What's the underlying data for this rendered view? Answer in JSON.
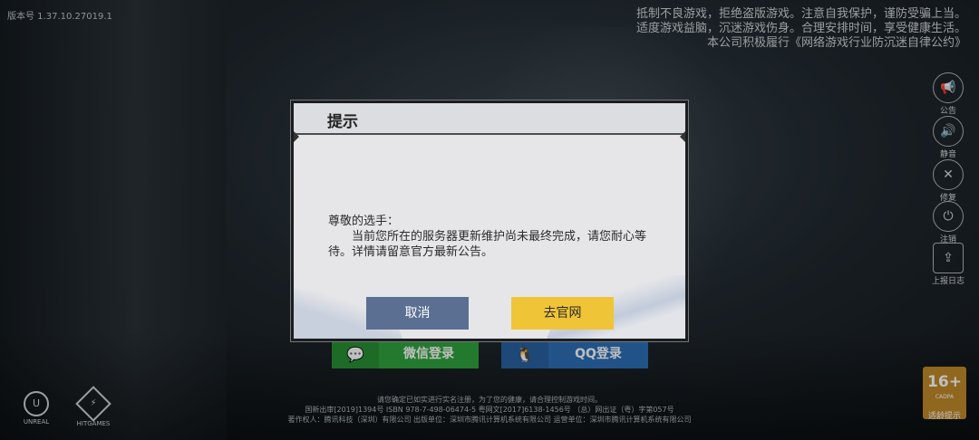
{
  "version": "版本号 1.37.10.27019.1",
  "notice": {
    "line1": "抵制不良游戏，拒绝盗版游戏。注意自我保护，谨防受骗上当。",
    "line2": "适度游戏益脑，沉迷游戏伤身。合理安排时间，享受健康生活。",
    "line3": "本公司积极履行《网络游戏行业防沉迷自律公约》"
  },
  "side_buttons": [
    {
      "icon": "megaphone-icon",
      "label": "公告"
    },
    {
      "icon": "speaker-icon",
      "label": "静音"
    },
    {
      "icon": "repair-icon",
      "label": "修复"
    },
    {
      "icon": "power-icon",
      "label": "注销"
    },
    {
      "icon": "upload-icon",
      "label": "上报日志"
    }
  ],
  "login": {
    "wechat_label": "微信登录",
    "qq_label": "QQ登录"
  },
  "legal": {
    "line1": "请您确定已如实进行实名注册，为了您的健康，请合理控制游戏时间。",
    "line2": "国新出审[2019]1394号  ISBN 978-7-498-06474-5  粤网文[2017]6138-1456号 （总）网出证（粤）字第057号",
    "line3": "著作权人：腾讯科技（深圳）有限公司    出版单位：深圳市腾讯计算机系统有限公司    运营单位：深圳市腾讯计算机系统有限公司"
  },
  "logos": {
    "unreal": "UNREAL",
    "timi": "HITGAMES"
  },
  "age_rating": {
    "value": "16+",
    "org": "CADPA",
    "label": "适龄提示"
  },
  "dialog": {
    "title": "提示",
    "greeting": "尊敬的选手：",
    "body": "当前您所在的服务器更新维护尚未最终完成，请您耐心等待。详情请留意官方最新公告。",
    "cancel_label": "取消",
    "site_label": "去官网"
  },
  "colors": {
    "cancel_button": "#5b6f92",
    "site_button": "#f0c437",
    "wechat_button": "#2fa33e",
    "qq_button": "#2d6fb7",
    "age_badge": "#c08a2a"
  }
}
